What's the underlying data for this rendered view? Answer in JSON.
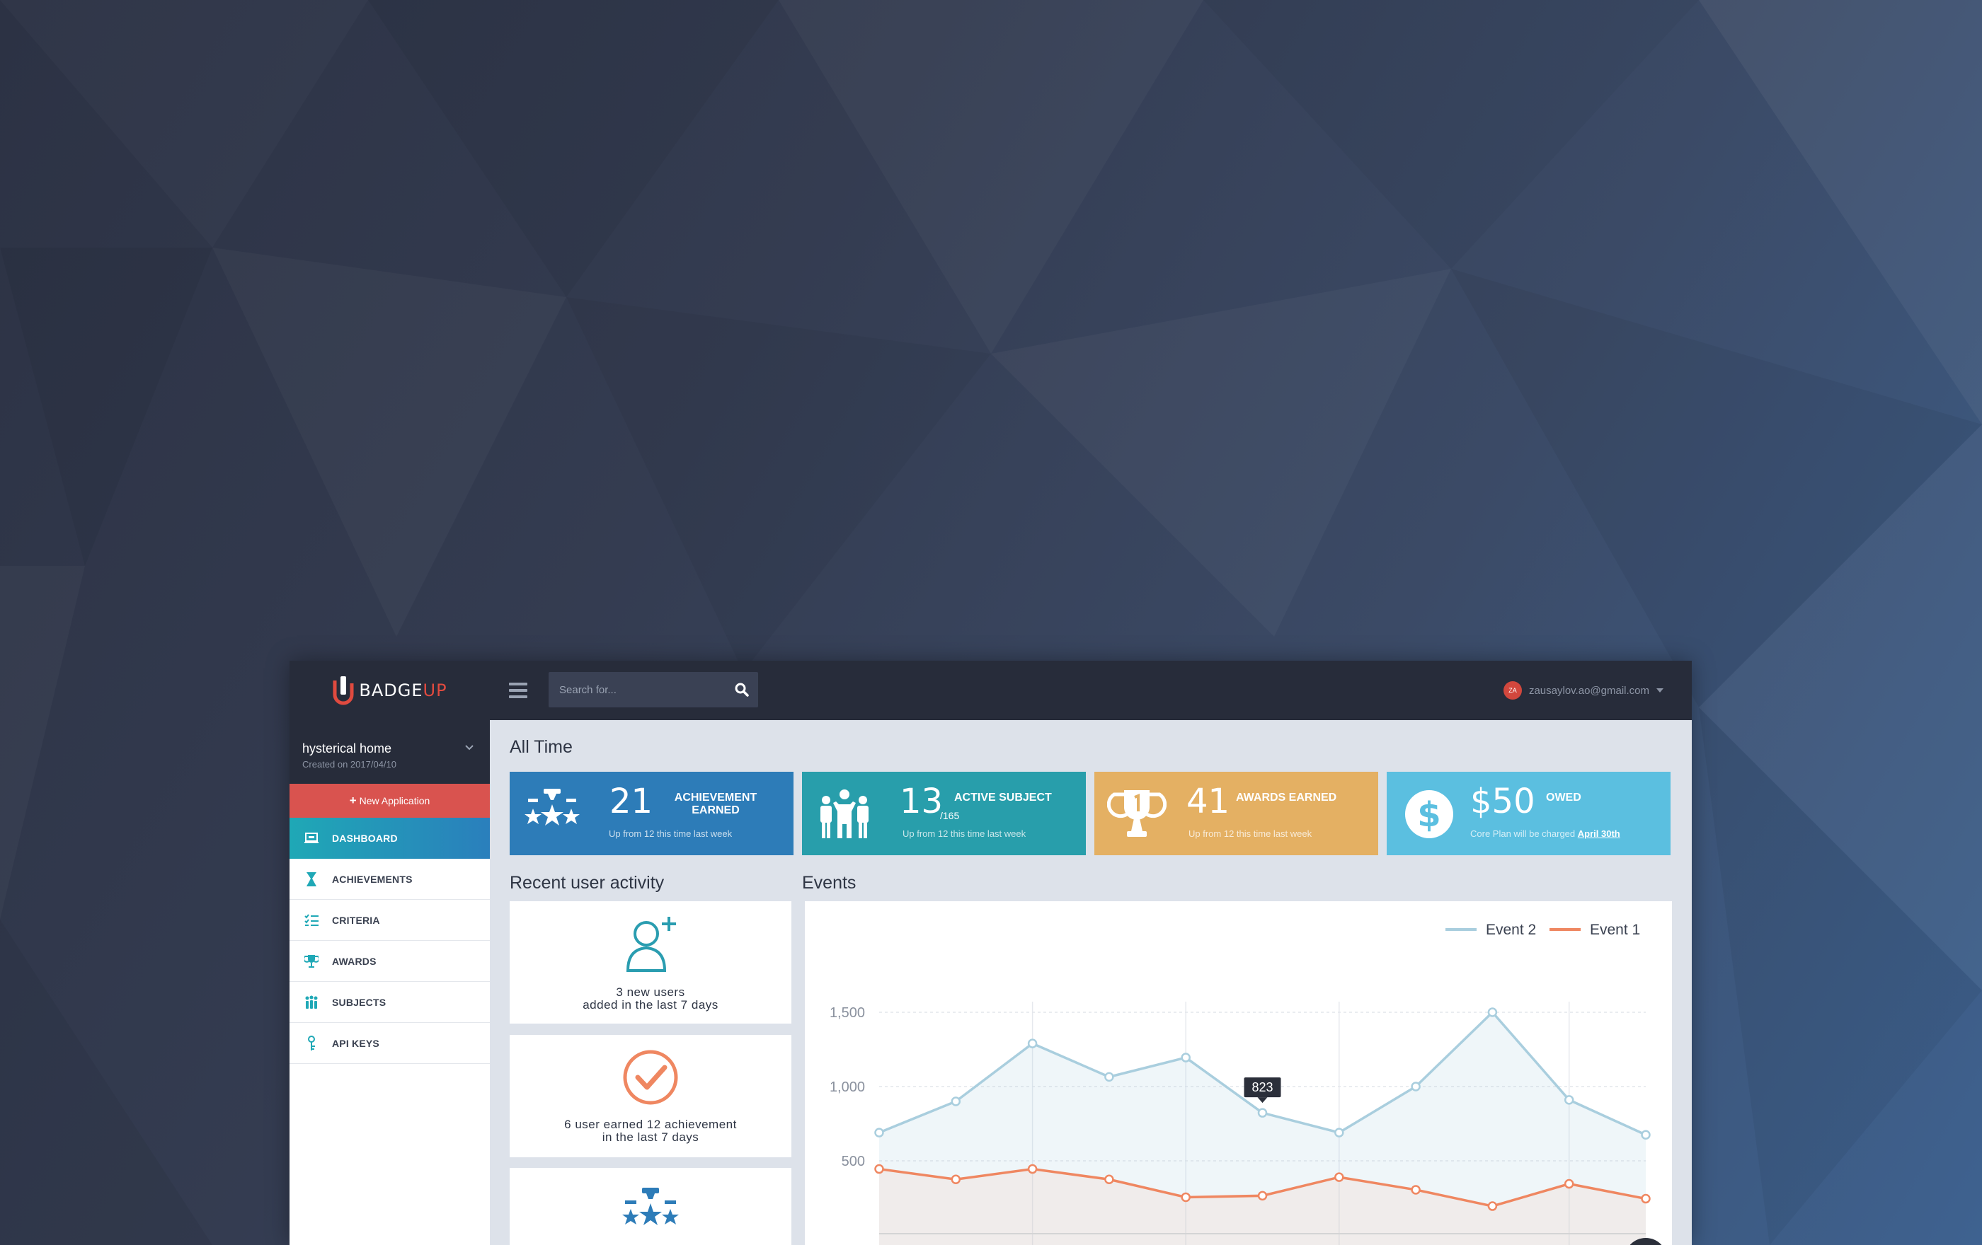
{
  "header": {
    "logo_prefix": "BADGE",
    "logo_suffix": "UP",
    "search_placeholder": "Search for...",
    "user_initials": "ZA",
    "user_email": "zausaylov.ao@gmail.com"
  },
  "sidebar": {
    "app_name": "hysterical home",
    "app_created": "Created on 2017/04/10",
    "new_app_label": "New Application",
    "items": [
      {
        "label": "DASHBOARD",
        "icon": "dashboard-icon"
      },
      {
        "label": "ACHIEVEMENTS",
        "icon": "hourglass-icon"
      },
      {
        "label": "CRITERIA",
        "icon": "checklist-icon"
      },
      {
        "label": "AWARDS",
        "icon": "trophy-icon"
      },
      {
        "label": "SUBJECTS",
        "icon": "people-icon"
      },
      {
        "label": "API KEYS",
        "icon": "key-icon"
      }
    ]
  },
  "main": {
    "title": "All Time",
    "stats": [
      {
        "value": "21",
        "label_line1": "ACHIEVEMENT",
        "label_line2": "EARNED",
        "note": "Up from 12 this time last week",
        "color": "#2d7cb8"
      },
      {
        "value": "13",
        "sub": "/165",
        "label_line1": "ACTIVE SUBJECT",
        "note": "Up from 12 this time last week",
        "color": "#289eab"
      },
      {
        "value": "41",
        "label_line1": "AWARDS EARNED",
        "note": "Up from 12 this time last week",
        "color": "#e4b063"
      },
      {
        "value": "$50",
        "label_line1": "OWED",
        "note": "Core Plan will be charged",
        "note_link": "April 30th",
        "color": "#5bbfe0"
      }
    ],
    "recent_title": "Recent user activity",
    "events_title": "Events",
    "activity": [
      {
        "line1": "3 new users",
        "line2": "added in the last 7 days"
      },
      {
        "line1": "6 user earned 12 achievement",
        "line2": "in the last 7 days"
      }
    ]
  },
  "chart_data": {
    "type": "line",
    "title": "",
    "xlabel": "",
    "ylabel": "",
    "ylim": [
      0,
      1550
    ],
    "yticks": [
      "500",
      "1,000",
      "1,500"
    ],
    "series": [
      {
        "name": "Event 2",
        "color": "#a9cede",
        "values": [
          690,
          900,
          1290,
          1065,
          1195,
          823,
          690,
          1000,
          1500,
          910,
          675
        ]
      },
      {
        "name": "Event 1",
        "color": "#ef8761",
        "values": [
          445,
          375,
          445,
          375,
          255,
          265,
          390,
          305,
          195,
          345,
          245
        ]
      }
    ],
    "tooltip": {
      "label": "823",
      "series": 0,
      "index": 5
    },
    "legend_position": "top-right",
    "grid": true
  }
}
